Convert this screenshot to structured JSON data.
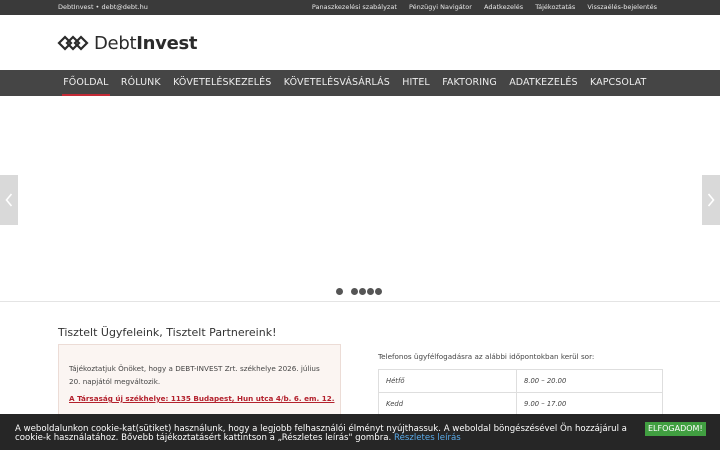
{
  "topbar": {
    "contact": "DebtInvest • debt@debt.hu",
    "links": [
      "Panaszkezelési szabályzat",
      "Pénzügyi Navigátor",
      "Adatkezelés",
      "Tájékoztatás",
      "Visszaélés-bejelentés"
    ]
  },
  "logo": {
    "light": "Debt",
    "bold": "Invest",
    "icon": "chain-link-logo-icon"
  },
  "nav": {
    "items": [
      "FŐOLDAL",
      "RÓLUNK",
      "KÖVETELÉSKEZELÉS",
      "KÖVETELÉSVÁSÁRLÁS",
      "HITEL",
      "FAKTORING",
      "ADATKEZELÉS",
      "KAPCSOLAT"
    ],
    "active": "FŐOLDAL"
  },
  "slider": {
    "slide_count": 5,
    "current_slide": 1,
    "prev_icon": "chevron-left-icon",
    "next_icon": "chevron-right-icon"
  },
  "content": {
    "heading": "Tisztelt Ügyfeleink, Tisztelt Partnereink!",
    "notice_text": "Tájékoztatjuk Önöket, hogy a DEBT-INVEST Zrt. székhelye 2026. július 20. napjától megváltozik.",
    "notice_link": "A Társaság új székhelye: 1135 Budapest, Hun utca 4/b. 6. em. 12.",
    "phone_intro": "Telefonos ügyfélfogadásra az alábbi időpontokban kerül sor:",
    "hours": [
      {
        "day": "Hétfő",
        "time": "8.00 – 20.00"
      },
      {
        "day": "Kedd",
        "time": "9.00 – 17.00"
      }
    ]
  },
  "cookie": {
    "text": "A weboldalunkon cookie-kat(sütiket) használunk, hogy a legjobb felhasználói élményt nyújthassuk. A weboldal böngészésével Ön hozzájárul a cookie-k használatához. Bővebb tájékoztatásért kattintson a „Részletes leírás\" gombra.",
    "link": "Részletes leírás",
    "accept": "ELFOGADOM!"
  },
  "colors": {
    "accent": "#c32a36",
    "nav_bg": "#454545",
    "topbar_bg": "#3a3a3a",
    "accept_bg": "#3b9c3b"
  }
}
